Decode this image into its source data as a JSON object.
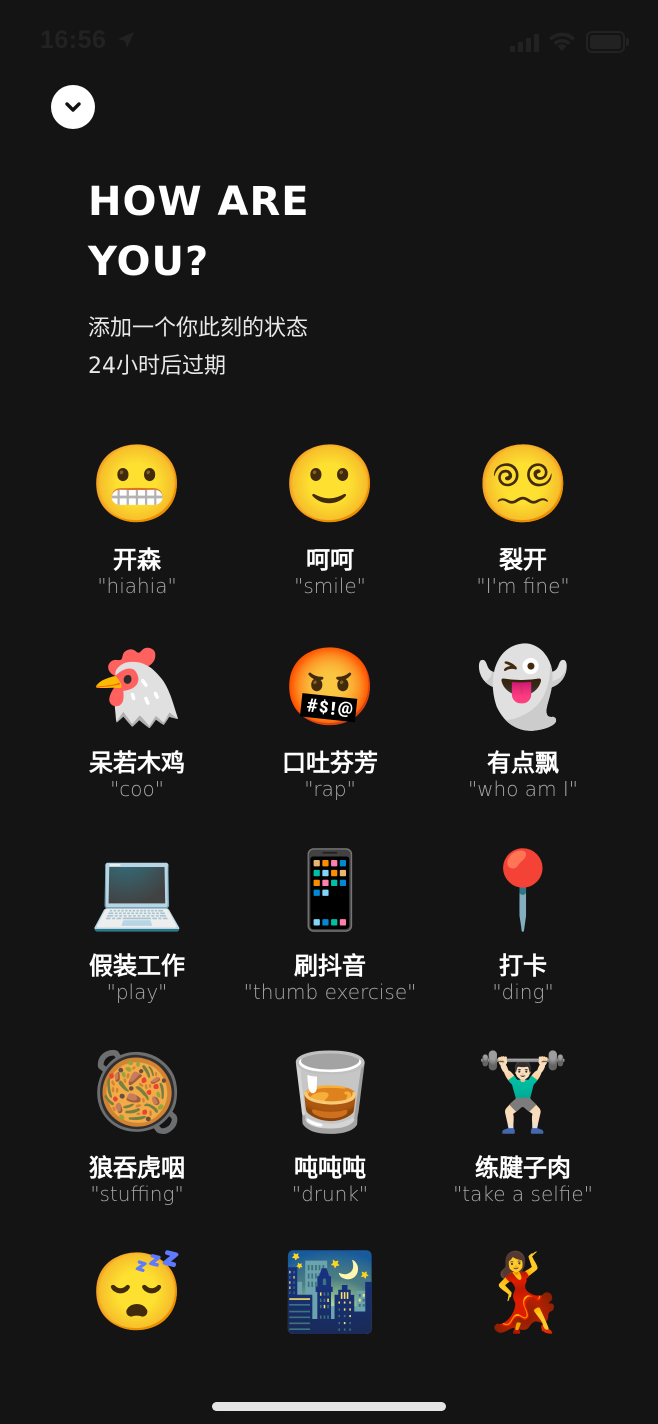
{
  "status_bar": {
    "time": "16:56"
  },
  "header": {
    "title_line1": "HOW ARE",
    "title_line2": "YOU?",
    "subtitle_line1": "添加一个你此刻的状态",
    "subtitle_line2": "24小时后过期"
  },
  "icons": {
    "dismiss": "chevron-down-icon",
    "location": "location-arrow-icon",
    "signal": "cellular-signal-icon",
    "wifi": "wifi-icon",
    "battery": "battery-icon"
  },
  "statuses": [
    {
      "emoji": "😬",
      "icon": "grimacing-face-icon",
      "name": "开森",
      "en": "\"hiahia\""
    },
    {
      "emoji": "🙂",
      "icon": "slightly-smiling-face-icon",
      "name": "呵呵",
      "en": "\"smile\""
    },
    {
      "emoji": "😵‍💫",
      "icon": "cracked-face-icon",
      "name": "裂开",
      "en": "\"I'm fine\""
    },
    {
      "emoji": "🐔",
      "icon": "chicken-icon",
      "name": "呆若木鸡",
      "en": "\"coo\""
    },
    {
      "emoji": "🤬",
      "icon": "cursing-face-icon",
      "name": "口吐芬芳",
      "en": "\"rap\""
    },
    {
      "emoji": "👻",
      "icon": "ghost-icon",
      "name": "有点飘",
      "en": "\"who am I\""
    },
    {
      "emoji": "💻",
      "icon": "laptop-icon",
      "name": "假装工作",
      "en": "\"play\""
    },
    {
      "emoji": "📱",
      "icon": "mobile-phone-icon",
      "name": "刷抖音",
      "en": "\"thumb exercise\""
    },
    {
      "emoji": "📍",
      "icon": "round-pushpin-icon",
      "name": "打卡",
      "en": "\"ding\""
    },
    {
      "emoji": "🥘",
      "icon": "shallow-pan-of-food-icon",
      "name": "狼吞虎咽",
      "en": "\"stuffing\""
    },
    {
      "emoji": "🥃",
      "icon": "tumbler-glass-icon",
      "name": "吨吨吨",
      "en": "\"drunk\""
    },
    {
      "emoji": "🏋🏻‍♂️",
      "icon": "weight-lifter-icon",
      "name": "练腱子肉",
      "en": "\"take a selfie\""
    },
    {
      "emoji": "😴",
      "icon": "sleeping-face-icon",
      "name": "",
      "en": ""
    },
    {
      "emoji": "🌃",
      "icon": "night-with-stars-icon",
      "name": "",
      "en": ""
    },
    {
      "emoji": "💃",
      "icon": "dancing-couple-icon",
      "name": "",
      "en": ""
    }
  ]
}
